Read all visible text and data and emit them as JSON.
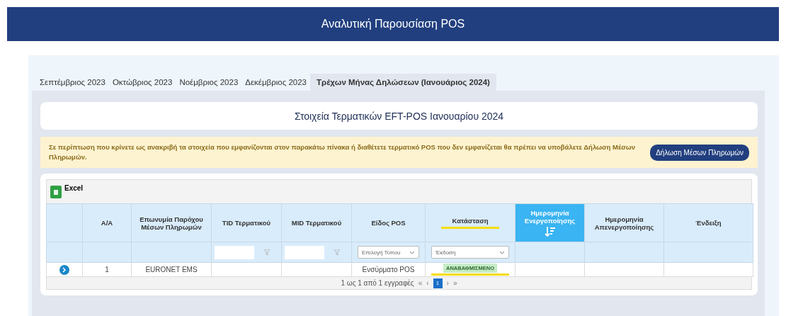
{
  "header": {
    "title": "Αναλυτική Παρουσίαση POS"
  },
  "tabs": [
    {
      "label": "Σεπτέμβριος 2023",
      "selected": false
    },
    {
      "label": "Οκτώβριος 2023",
      "selected": false
    },
    {
      "label": "Νοέμβριος 2023",
      "selected": false
    },
    {
      "label": "Δεκέμβριος 2023",
      "selected": false
    },
    {
      "label": "Τρέχων Μήνας Δηλώσεων (Ιανουάριος 2024)",
      "selected": true
    }
  ],
  "panel_title": "Στοιχεία Τερματικών EFT-POS Ιανουαρίου 2024",
  "alert": {
    "text": "Σε περίπτωση που κρίνετε ως ανακριβή τα στοιχεία που εμφανίζονται στον παρακάτω πίνακα ή διαθέτετε τερματικό POS που δεν εμφανίζεται θα πρέπει να υποβάλετε Δήλωση Μέσων Πληρωμών.",
    "button": "Δήλωση Μέσων Πληρωμών"
  },
  "table": {
    "export_button": "Excel",
    "columns": [
      {
        "kind": "expander",
        "sorted": false,
        "highlighted": false
      },
      {
        "label": "Α/Α",
        "kind": "plain",
        "sorted": false,
        "highlighted": false
      },
      {
        "label": "Επωνυμία Παρόχου Μέσων Πληρωμών",
        "kind": "plain",
        "sorted": false,
        "highlighted": false
      },
      {
        "label": "TID Τερματικού",
        "kind": "text_filter",
        "sorted": false,
        "highlighted": false
      },
      {
        "label": "MID Τερματικού",
        "kind": "text_filter",
        "sorted": false,
        "highlighted": false
      },
      {
        "label": "Είδος POS",
        "kind": "select_filter",
        "placeholder": "Επιλογή Τύπου",
        "sorted": false,
        "highlighted": false
      },
      {
        "label": "Κατάσταση",
        "kind": "select_filter",
        "placeholder": "Έκδοση",
        "sorted": false,
        "highlighted": true
      },
      {
        "label": "Ημερομηνία Ενεργοποίησης",
        "kind": "plain",
        "sorted": true,
        "highlighted": false
      },
      {
        "label": "Ημερομηνία Απενεργοποίησης",
        "kind": "plain",
        "sorted": false,
        "highlighted": false
      },
      {
        "label": "Ένδειξη",
        "kind": "plain",
        "sorted": false,
        "highlighted": false
      }
    ],
    "rows": [
      {
        "cells": [
          "",
          "1",
          "EURONET EMS",
          "",
          "",
          "Ενσύρματο POS",
          "ΑΝΑΒΑΘΜΙΣΜΕΝΟ",
          "",
          "",
          ""
        ],
        "status_highlighted": true
      }
    ],
    "pager": {
      "summary": "1 ως 1 από 1 εγγραφές",
      "first": "«",
      "prev": "‹",
      "pages": [
        {
          "label": "1",
          "selected": true
        }
      ],
      "next": "›",
      "last": "»"
    }
  }
}
